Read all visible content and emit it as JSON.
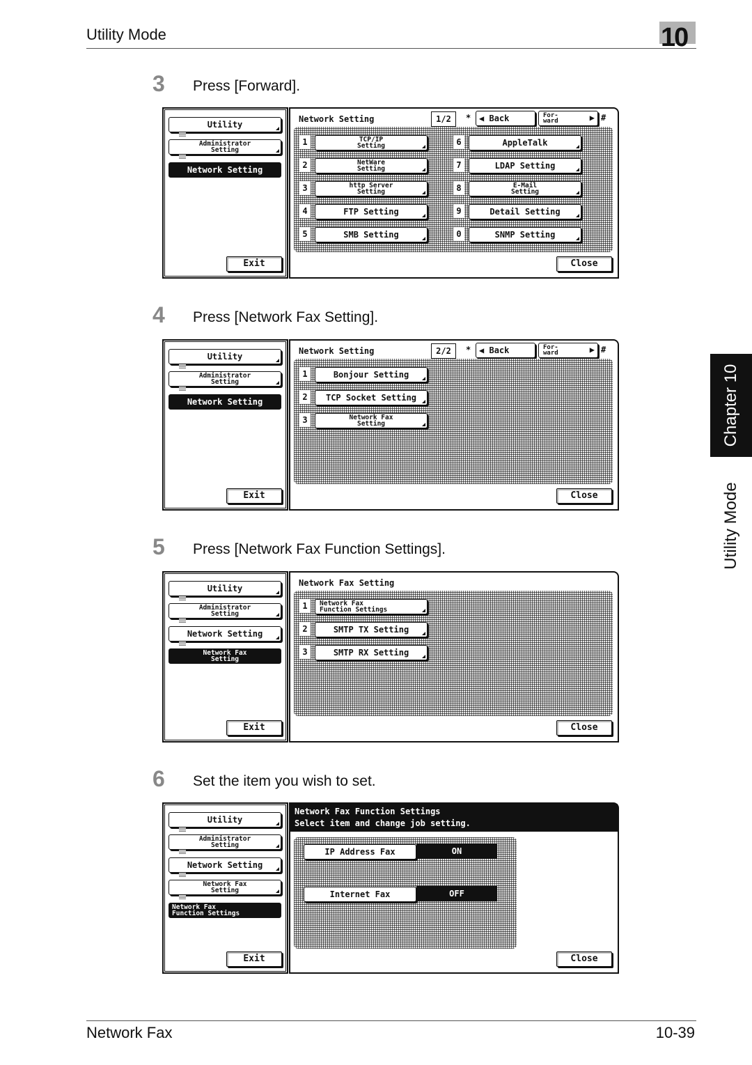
{
  "header": {
    "section_title": "Utility Mode",
    "chapter_number": "10"
  },
  "side_tab": {
    "chapter_label": "Chapter 10",
    "mode_label": "Utility Mode"
  },
  "footer": {
    "left": "Network Fax",
    "page": "10-39"
  },
  "steps": [
    {
      "number": "3",
      "text": "Press [Forward]."
    },
    {
      "number": "4",
      "text": "Press [Network Fax Setting]."
    },
    {
      "number": "5",
      "text": "Press [Network Fax Function Settings]."
    },
    {
      "number": "6",
      "text": "Set the item you wish to set."
    }
  ],
  "common": {
    "exit": "Exit",
    "close": "Close",
    "back": "Back",
    "forward_line1": "For-",
    "forward_line2": "ward",
    "star": "*",
    "hash": "#"
  },
  "screen3": {
    "left": [
      {
        "label": "Utility"
      },
      {
        "line1": "Administrator",
        "line2": "Setting"
      },
      {
        "label": "Network Setting",
        "selected": true
      }
    ],
    "title": "Network Setting",
    "page": "1/2",
    "items": [
      {
        "num": "1",
        "line1": "TCP/IP",
        "line2": "Setting"
      },
      {
        "num": "2",
        "line1": "NetWare",
        "line2": "Setting"
      },
      {
        "num": "3",
        "line1": "http Server",
        "line2": "Setting"
      },
      {
        "num": "4",
        "label": "FTP Setting"
      },
      {
        "num": "5",
        "label": "SMB Setting"
      },
      {
        "num": "6",
        "label": "AppleTalk"
      },
      {
        "num": "7",
        "label": "LDAP Setting"
      },
      {
        "num": "8",
        "line1": "E-Mail",
        "line2": "Setting"
      },
      {
        "num": "9",
        "label": "Detail Setting"
      },
      {
        "num": "0",
        "label": "SNMP Setting"
      }
    ]
  },
  "screen4": {
    "left": [
      {
        "label": "Utility"
      },
      {
        "line1": "Administrator",
        "line2": "Setting"
      },
      {
        "label": "Network Setting",
        "selected": true
      }
    ],
    "title": "Network Setting",
    "page": "2/2",
    "items": [
      {
        "num": "1",
        "label": "Bonjour Setting"
      },
      {
        "num": "2",
        "label": "TCP Socket Setting"
      },
      {
        "num": "3",
        "line1": "Network Fax",
        "line2": "Setting"
      }
    ]
  },
  "screen5": {
    "left": [
      {
        "label": "Utility"
      },
      {
        "line1": "Administrator",
        "line2": "Setting"
      },
      {
        "label": "Network Setting"
      },
      {
        "line1": "Network Fax",
        "line2": "Setting",
        "selected": true
      }
    ],
    "title": "Network Fax Setting",
    "items": [
      {
        "num": "1",
        "line1": "Network Fax",
        "line2": "Function Settings"
      },
      {
        "num": "2",
        "label": "SMTP TX Setting"
      },
      {
        "num": "3",
        "label": "SMTP RX Setting"
      }
    ]
  },
  "screen6": {
    "left": [
      {
        "label": "Utility"
      },
      {
        "line1": "Administrator",
        "line2": "Setting"
      },
      {
        "label": "Network Setting"
      },
      {
        "line1": "Network Fax",
        "line2": "Setting"
      },
      {
        "line1": "Network Fax",
        "line2": "Function Settings",
        "selected": true
      }
    ],
    "title": "Network Fax Function Settings",
    "subtitle": "Select item and change job setting.",
    "functions": [
      {
        "label": "IP Address Fax",
        "value": "ON"
      },
      {
        "label": "Internet Fax",
        "value": "OFF"
      }
    ]
  }
}
